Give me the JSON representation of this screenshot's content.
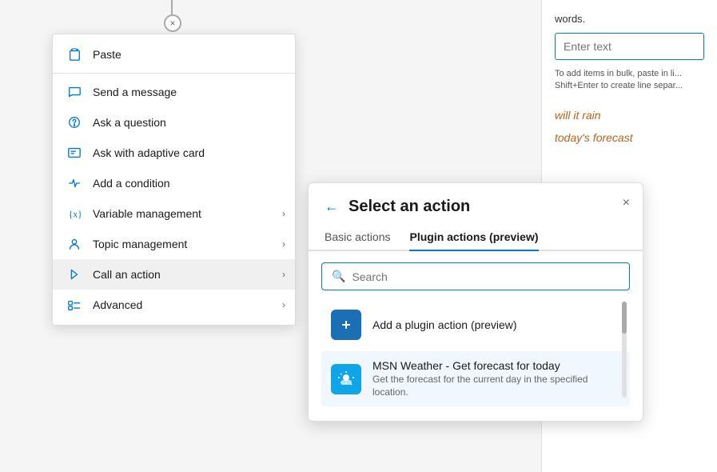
{
  "background": {
    "words_label": "words.",
    "enter_text_placeholder": "Enter text",
    "hint_text": "To add items in bulk, paste in li... Shift+Enter to create line separ...",
    "phrase1": "will it rain",
    "phrase2": "today's forecast"
  },
  "connector": {
    "close_symbol": "×"
  },
  "context_menu": {
    "items": [
      {
        "id": "paste",
        "label": "Paste",
        "icon": "paste-icon",
        "has_chevron": false
      },
      {
        "id": "send-message",
        "label": "Send a message",
        "icon": "message-icon",
        "has_chevron": false
      },
      {
        "id": "ask-question",
        "label": "Ask a question",
        "icon": "question-icon",
        "has_chevron": false
      },
      {
        "id": "ask-adaptive",
        "label": "Ask with adaptive card",
        "icon": "adaptive-icon",
        "has_chevron": false
      },
      {
        "id": "add-condition",
        "label": "Add a condition",
        "icon": "condition-icon",
        "has_chevron": false
      },
      {
        "id": "variable",
        "label": "Variable management",
        "icon": "variable-icon",
        "has_chevron": true
      },
      {
        "id": "topic",
        "label": "Topic management",
        "icon": "topic-icon",
        "has_chevron": true
      },
      {
        "id": "call-action",
        "label": "Call an action",
        "icon": "action-icon",
        "has_chevron": true,
        "active": true
      },
      {
        "id": "advanced",
        "label": "Advanced",
        "icon": "advanced-icon",
        "has_chevron": true
      }
    ]
  },
  "action_panel": {
    "back_label": "←",
    "title": "Select an action",
    "close_label": "×",
    "tabs": [
      {
        "id": "basic",
        "label": "Basic actions",
        "active": false
      },
      {
        "id": "plugin",
        "label": "Plugin actions (preview)",
        "active": true
      }
    ],
    "search_placeholder": "Search",
    "actions": [
      {
        "id": "add-plugin",
        "name": "Add a plugin action (preview)",
        "description": "",
        "icon_type": "blue",
        "icon_symbol": "⊕"
      },
      {
        "id": "msn-weather",
        "name": "MSN Weather - Get forecast for today",
        "description": "Get the forecast for the current day in the specified location.",
        "icon_type": "blue-bright",
        "icon_symbol": "☀"
      }
    ]
  }
}
